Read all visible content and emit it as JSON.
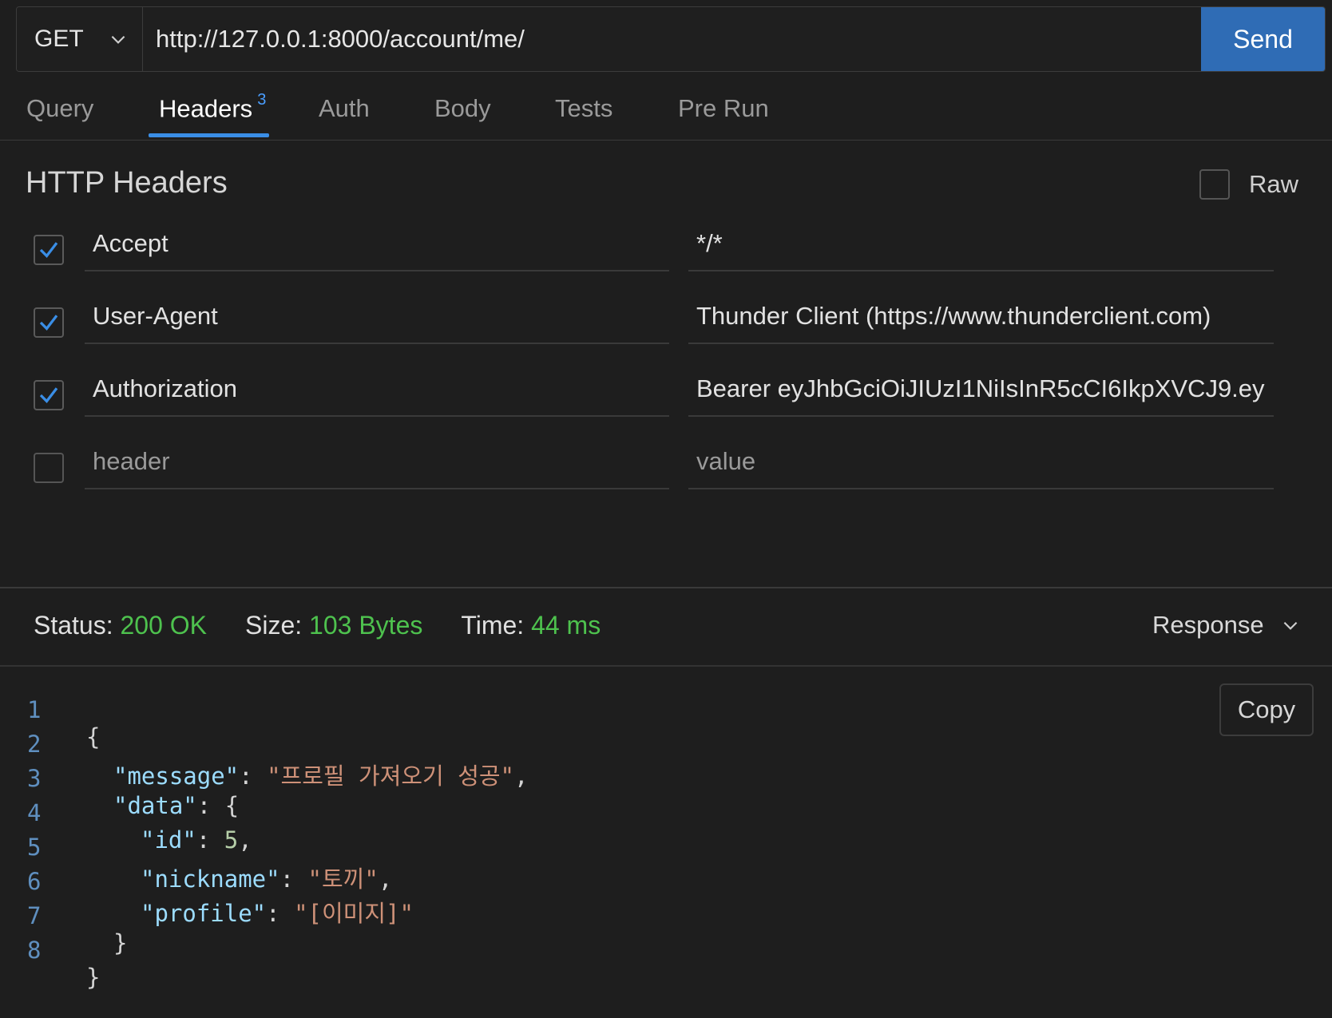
{
  "request": {
    "method": "GET",
    "url": "http://127.0.0.1:8000/account/me/",
    "send_label": "Send"
  },
  "tabs": [
    {
      "label": "Query"
    },
    {
      "label": "Headers",
      "badge": "3",
      "active": true
    },
    {
      "label": "Auth"
    },
    {
      "label": "Body"
    },
    {
      "label": "Tests"
    },
    {
      "label": "Pre Run"
    }
  ],
  "headers_section": {
    "title": "HTTP Headers",
    "raw_label": "Raw",
    "rows": [
      {
        "checked": true,
        "key": "Accept",
        "value": "*/*"
      },
      {
        "checked": true,
        "key": "User-Agent",
        "value": "Thunder Client (https://www.thunderclient.com)"
      },
      {
        "checked": true,
        "key": "Authorization",
        "value": "Bearer eyJhbGciOiJIUzI1NiIsInR5cCI6IkpXVCJ9.ey"
      },
      {
        "checked": false,
        "key_placeholder": "header",
        "value_placeholder": "value"
      }
    ]
  },
  "response": {
    "status_label": "Status:",
    "status_value": "200 OK",
    "size_label": "Size:",
    "size_value": "103 Bytes",
    "time_label": "Time:",
    "time_value": "44 ms",
    "view_label": "Response",
    "copy_label": "Copy",
    "status_color": "#4ec24e"
  },
  "code_lines": [
    {
      "num": "1",
      "text": "{"
    },
    {
      "num": "2",
      "key": "\"message\"",
      "sep": ": ",
      "str": "\"프로필 가져오기 성공\"",
      "end": ","
    },
    {
      "num": "3",
      "key": "\"data\"",
      "sep": ": ",
      "end": "{"
    },
    {
      "num": "4",
      "key": "\"id\"",
      "sep": ": ",
      "numval": "5",
      "end": ","
    },
    {
      "num": "5",
      "key": "\"nickname\"",
      "sep": ": ",
      "str": "\"토끼\"",
      "end": ","
    },
    {
      "num": "6",
      "key": "\"profile\"",
      "sep": ": ",
      "str": "\"[이미지]\"",
      "end": ""
    },
    {
      "num": "7",
      "text": "}"
    },
    {
      "num": "8",
      "text": "}"
    }
  ]
}
